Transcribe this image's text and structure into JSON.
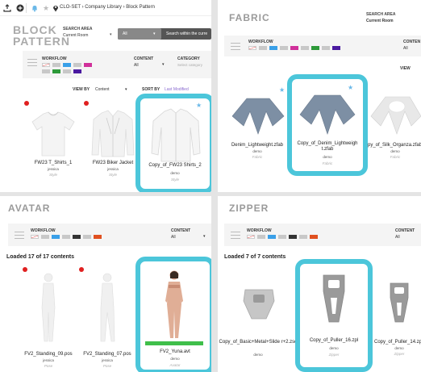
{
  "block": {
    "toolbar": {
      "upload_icon": "upload-icon",
      "add_icon": "plus-circle-icon",
      "bell_icon": "bell-icon",
      "star_icon": "star-icon",
      "pin_icon": "location-pin-icon",
      "breadcrumb": "CLO-SET › Company Library › Block Pattern"
    },
    "title_line1": "BLOCK",
    "title_line2": "PATTERN",
    "search_area_label": "SEARCH AREA",
    "search_area_value": "Current Room",
    "search_scope": "All",
    "search_placeholder": "Search within the curre",
    "workflow_label": "WORKFLOW",
    "content_label": "CONTENT",
    "content_value": "All",
    "category_label": "CATEGORY",
    "category_placeholder": "Select category",
    "view_by_label": "VIEW BY",
    "view_by_value": "Content",
    "sort_by_label": "SORT BY",
    "sort_by_value": "Last Modified",
    "items": [
      {
        "name": "FW23 T_Shirts_1",
        "user": "jessica",
        "type": "Style"
      },
      {
        "name": "FW23 Biker Jacket",
        "user": "jessica",
        "type": "Style"
      },
      {
        "name": "Copy_of_FW23 Shirts_2",
        "user": "demo",
        "type": "Style"
      }
    ]
  },
  "fabric": {
    "title": "FABRIC",
    "search_area_label": "SEARCH AREA",
    "search_area_value": "Current Room",
    "workflow_label": "WORKFLOW",
    "content_label": "CONTEN",
    "content_value": "All",
    "view_label": "VIEW",
    "items": [
      {
        "name": "Denim_Lightweight.zfab",
        "user": "demo",
        "type": "Fabric"
      },
      {
        "name": "Copy_of_Denim_Lightweigh t.zfab",
        "user": "demo",
        "type": "Fabric"
      },
      {
        "name": "py_of_Silk_Organza.zfab",
        "user": "demo",
        "type": "Fabric"
      }
    ]
  },
  "avatar": {
    "title": "AVATAR",
    "workflow_label": "WORKFLOW",
    "content_label": "CONTENT",
    "content_value": "All",
    "loaded_text": "Loaded 17 of 17 contents",
    "items": [
      {
        "name": "FV2_Standing_09.pos",
        "user": "jessica",
        "type": "Pose"
      },
      {
        "name": "FV2_Standing_07.pos",
        "user": "jessica",
        "type": "Pose"
      },
      {
        "name": "FV2_Yuna.avt",
        "user": "demo",
        "type": "Avatar"
      }
    ]
  },
  "zipper": {
    "title": "ZIPPER",
    "workflow_label": "WORKFLOW",
    "content_label": "CONTENT",
    "content_value": "All",
    "loaded_text": "Loaded 7 of 7 contents",
    "items": [
      {
        "name": "Copy_of_Basic+Metal+Slide r+2.zsd",
        "user": "demo",
        "type": ""
      },
      {
        "name": "Copy_of_Puller_16.zpl",
        "user": "demo",
        "type": "Zipper"
      },
      {
        "name": "Copy_of_Puller_14.zp",
        "user": "demo",
        "type": "Zipper"
      }
    ]
  },
  "colors": {
    "highlight": "#4cc6da",
    "star": "#6ab8e8",
    "dot": "#e02020"
  }
}
